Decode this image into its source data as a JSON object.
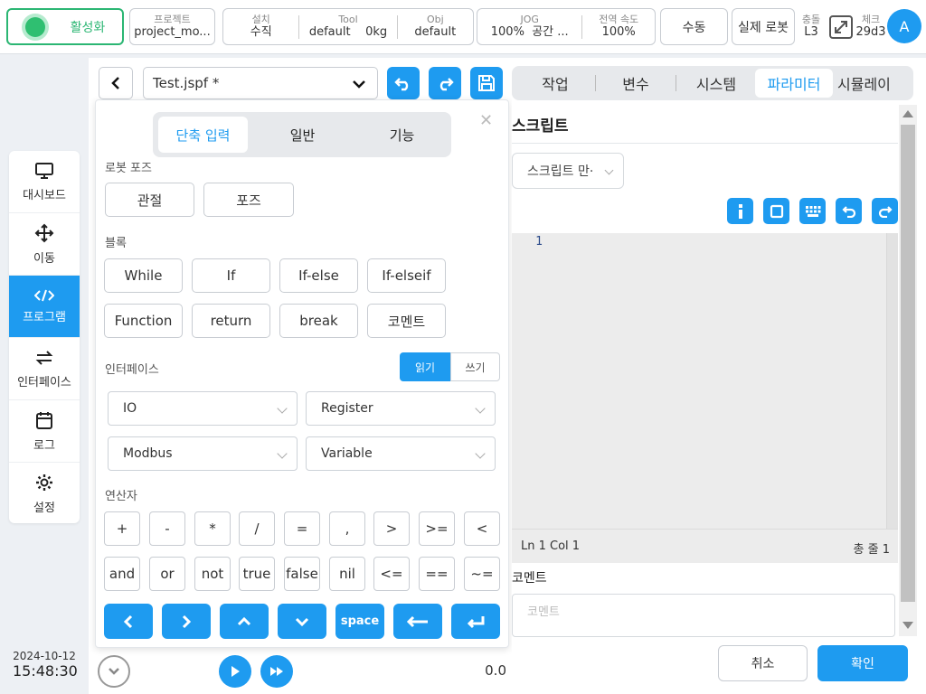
{
  "topbar": {
    "activate_label": "활성화",
    "project_label": "프로젝트",
    "project_value": "project_mo...",
    "install_label": "설치",
    "install_value": "수직",
    "tool_label": "Tool",
    "tool_value": "default",
    "tool_weight": "0kg",
    "obj_label": "Obj",
    "obj_value": "default",
    "jog_label": "JOG",
    "jog_value": "100%",
    "jog_space": "공간 ...",
    "speed_label": "전역 속도",
    "speed_value": "100%",
    "manual_label": "수동",
    "real_robot_label": "실제 로봇",
    "collision_label": "충돌",
    "collision_value": "L3",
    "check_label": "체크",
    "check_value": "29d3",
    "avatar_letter": "A"
  },
  "sidebar": {
    "items": [
      {
        "label": "대시보드",
        "icon": "monitor-icon"
      },
      {
        "label": "이동",
        "icon": "move-icon"
      },
      {
        "label": "프로그램",
        "icon": "code-icon"
      },
      {
        "label": "인터페이스",
        "icon": "swap-icon"
      },
      {
        "label": "로그",
        "icon": "calendar-icon"
      },
      {
        "label": "설정",
        "icon": "gear-icon"
      }
    ],
    "date": "2024-10-12",
    "time": "15:48:30"
  },
  "editor": {
    "file_name": "Test.jspf *",
    "tabs": [
      "단축 입력",
      "일반",
      "기능"
    ],
    "robot_pose_label": "로봇 포즈",
    "pose_buttons": [
      "관절",
      "포즈"
    ],
    "block_label": "블록",
    "block_buttons": [
      "While",
      "If",
      "If-else",
      "If-elseif",
      "Function",
      "return",
      "break",
      "코멘트"
    ],
    "interface_label": "인터페이스",
    "read_label": "읽기",
    "write_label": "쓰기",
    "selects": [
      "IO",
      "Register",
      "Modbus",
      "Variable"
    ],
    "operator_label": "연산자",
    "operators_row1": [
      "+",
      "-",
      "*",
      "/",
      "=",
      ",",
      ">",
      ">=",
      "<"
    ],
    "operators_row2": [
      "and",
      "or",
      "not",
      "true",
      "false",
      "nil",
      "<=",
      "==",
      "~="
    ],
    "space_label": "space",
    "speed_display": "0.0"
  },
  "right": {
    "tabs": [
      "작업",
      "변수",
      "시스템",
      "파라미터",
      "시뮬레이"
    ],
    "active_tab": "파라미터",
    "title": "스크립트",
    "script_select": "스크립트 만·",
    "line_number": "1",
    "status_position": "Ln 1 Col 1",
    "status_total": "총 줄 1",
    "comment_label": "코멘트",
    "comment_placeholder": "코멘트",
    "cancel_label": "취소",
    "confirm_label": "확인"
  },
  "colors": {
    "accent": "#1e9bf0",
    "active_green": "#2bb673"
  }
}
